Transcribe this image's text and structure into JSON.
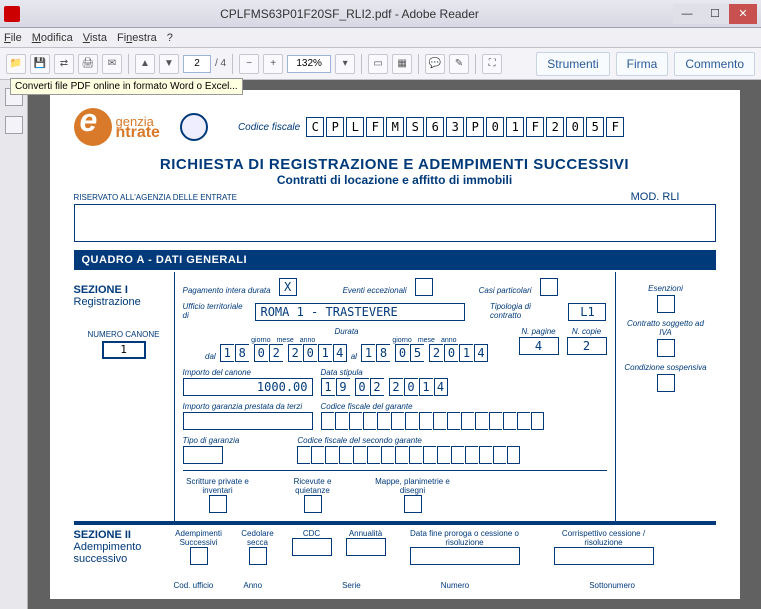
{
  "window": {
    "title": "CPLFMS63P01F20SF_RLI2.pdf - Adobe Reader"
  },
  "menu": {
    "file": "File",
    "modifica": "Modifica",
    "vista": "Vista",
    "finestra": "Finestra",
    "help": "?"
  },
  "toolbar": {
    "page": "2",
    "pages": "/ 4",
    "zoom": "132%",
    "strumenti": "Strumenti",
    "firma": "Firma",
    "commento": "Commento"
  },
  "tooltip": "Converti file PDF online in formato Word o Excel...",
  "doc": {
    "cf_label": "Codice fiscale",
    "cf": [
      "C",
      "P",
      "L",
      "F",
      "M",
      "S",
      "6",
      "3",
      "P",
      "0",
      "1",
      "F",
      "2",
      "0",
      "5",
      "F"
    ],
    "title": "RICHIESTA DI REGISTRAZIONE E ADEMPIMENTI SUCCESSIVI",
    "subtitle": "Contratti di locazione e affitto di immobili",
    "mod": "MOD. RLI",
    "reserved": "RISERVATO ALL'AGENZIA DELLE ENTRATE",
    "quadroA": "QUADRO A - DATI GENERALI",
    "sez1": {
      "t": "SEZIONE I",
      "s": "Registrazione"
    },
    "numcan_label": "NUMERO CANONE",
    "numcan": "1",
    "pag_intera": "Pagamento intera durata",
    "pag_intera_v": "X",
    "eventi": "Eventi eccezionali",
    "casi": "Casi particolari",
    "ufficio_l": "Ufficio territoriale di",
    "ufficio": "ROMA 1 - TRASTEVERE",
    "tip_l": "Tipologia di contratto",
    "tip": "L1",
    "durata": "Durata",
    "dal": "dal",
    "al": "al",
    "giorno": "giorno",
    "mese": "mese",
    "anno": "anno",
    "d1": [
      "1",
      "8",
      "0",
      "2",
      "2",
      "0",
      "1",
      "4"
    ],
    "d2": [
      "1",
      "8",
      "0",
      "5",
      "2",
      "0",
      "1",
      "4"
    ],
    "npag_l": "N. pagine",
    "npag": "4",
    "ncop_l": "N. copie",
    "ncop": "2",
    "impcan_l": "Importo del canone",
    "impcan": "1000.00",
    "datastip_l": "Data stipula",
    "d3": [
      "1",
      "9",
      "0",
      "2",
      "2",
      "0",
      "1",
      "4"
    ],
    "garanzia_l": "Importo garanzia prestata da terzi",
    "cfgar_l": "Codice fiscale del garante",
    "tipogar_l": "Tipo di garanzia",
    "cfgar2_l": "Codice fiscale del secondo garante",
    "scr": "Scritture private e inventari",
    "ric": "Ricevute e quietanze",
    "map": "Mappe, planimetrie e disegni",
    "esen": "Esenzioni",
    "iva": "Contratto soggetto ad IVA",
    "cond": "Condizione sospensiva",
    "sez2": {
      "t": "SEZIONE II",
      "s1": "Adempimento",
      "s2": "successivo"
    },
    "adem": "Adempimenti Successivi",
    "ced": "Cedolare secca",
    "cdc": "CDC",
    "ann": "Annualità",
    "datafine": "Data fine proroga o cessione o risoluzione",
    "corr": "Corrispettivo cessione / risoluzione",
    "coduf": "Cod. ufficio",
    "anno_l": "Anno",
    "serie": "Serie",
    "numero": "Numero",
    "sotto": "Sottonumero"
  }
}
